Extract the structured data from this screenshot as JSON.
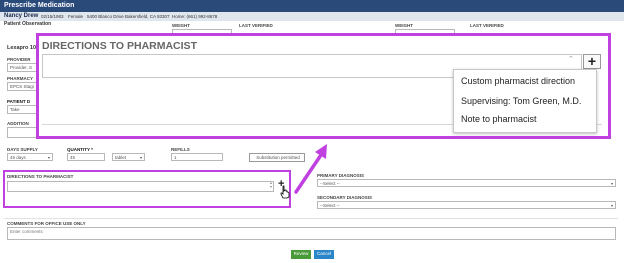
{
  "window": {
    "title": "Prescribe Medication"
  },
  "patient": {
    "name": "Nancy Drew",
    "dob": "02/15/1983",
    "gender": "Female",
    "address": "5400 Blanco Drive Bakersfield, CA 93307",
    "phone": "Home: (661) 992-8678"
  },
  "observation": {
    "heading": "Patient Observation",
    "weight_label": "WEIGHT",
    "last_verified_label": "LAST VERIFIED"
  },
  "drug": {
    "name": "Lexapro 10"
  },
  "labels": {
    "provider": "PROVIDER",
    "provider_value": "Provider, S",
    "pharmacy": "PHARMACY",
    "pharmacy_value": "EPCS Stagi",
    "patient_directions": "PATIENT D",
    "patient_directions_value": "Take",
    "additional": "ADDITION"
  },
  "supply": {
    "days_label": "DAYS SUPPLY",
    "days_value": "45 days",
    "quantity_label": "QUANTITY *",
    "quantity_value": "45",
    "unit_value": "tablet",
    "refills_label": "REFILLS",
    "refills_value": "1",
    "substitution_label": "Substitution permitted"
  },
  "directions": {
    "label": "DIRECTIONS TO PHARMACIST"
  },
  "diagnosis": {
    "primary_label": "PRIMARY DIAGNOSIS",
    "primary_value": "--Select --",
    "secondary_label": "SECONDARY DIAGNOSIS",
    "secondary_value": "--Select --"
  },
  "comments": {
    "label": "COMMENTS FOR OFFICE USE ONLY",
    "placeholder": "Enter comments"
  },
  "buttons": {
    "review": "Review",
    "cancel": "Cancel"
  },
  "popup": {
    "title": "DIRECTIONS TO PHARMACIST",
    "menu": [
      "Custom pharmacist direction",
      "Supervising: Tom Green, M.D.",
      "Note to pharmacist"
    ]
  },
  "colors": {
    "highlight": "#c040e0",
    "titlebar": "#2a4a7a",
    "review": "#4a9a3a",
    "cancel": "#2a86c8"
  }
}
